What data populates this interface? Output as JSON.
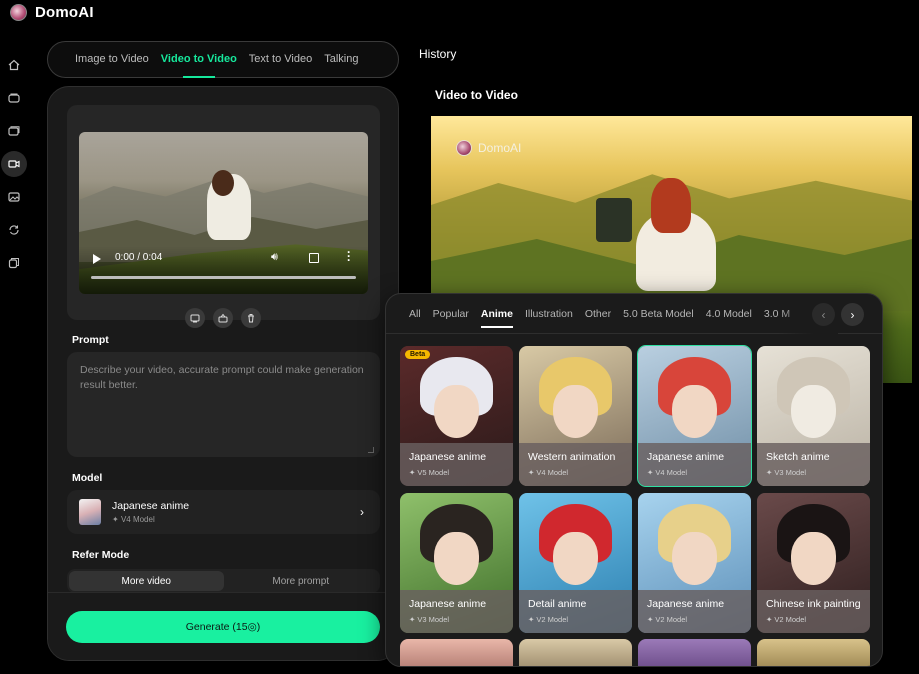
{
  "brand": {
    "name": "DomoAI"
  },
  "nav_rail": [
    {
      "icon": "home-icon"
    },
    {
      "icon": "gallery-icon"
    },
    {
      "icon": "folder-icon"
    },
    {
      "icon": "video-icon",
      "active": true
    },
    {
      "icon": "image-icon"
    },
    {
      "icon": "refresh-icon"
    },
    {
      "icon": "copy-icon"
    }
  ],
  "mode_tabs": [
    "Image to Video",
    "Video to Video",
    "Text to Video",
    "Talking"
  ],
  "active_tab": "Video to Video",
  "video": {
    "time": "0:00 / 0:04"
  },
  "prompt": {
    "label": "Prompt",
    "placeholder": "Describe your video, accurate prompt could make generation result better.",
    "value": ""
  },
  "model": {
    "label": "Model",
    "name": "Japanese anime",
    "version": "V4 Model"
  },
  "refer_mode": {
    "label": "Refer Mode",
    "options": [
      "More video",
      "More prompt"
    ],
    "selected": "More video"
  },
  "generate": {
    "label": "Generate (15◎)"
  },
  "history": {
    "title": "History",
    "item_title": "Video to Video",
    "watermark": "DomoAI"
  },
  "style_picker": {
    "categories": [
      "All",
      "Popular",
      "Anime",
      "Illustration",
      "Other",
      "5.0 Beta Model",
      "4.0 Model",
      "3.0 M"
    ],
    "active_category": "Anime",
    "cards": [
      {
        "name": "Japanese anime",
        "version": "V5 Model",
        "badge": "Beta"
      },
      {
        "name": "Western animation",
        "version": "V4 Model"
      },
      {
        "name": "Japanese anime",
        "version": "V4 Model",
        "selected": true
      },
      {
        "name": "Sketch anime",
        "version": "V3 Model"
      },
      {
        "name": "Japanese anime",
        "version": "V3 Model"
      },
      {
        "name": "Detail anime",
        "version": "V2 Model"
      },
      {
        "name": "Japanese anime",
        "version": "V2 Model"
      },
      {
        "name": "Chinese ink painting",
        "version": "V2 Model"
      }
    ]
  },
  "colors": {
    "accent": "#16e89c",
    "generate": "#19f0a0",
    "badge": "#f5b800"
  }
}
